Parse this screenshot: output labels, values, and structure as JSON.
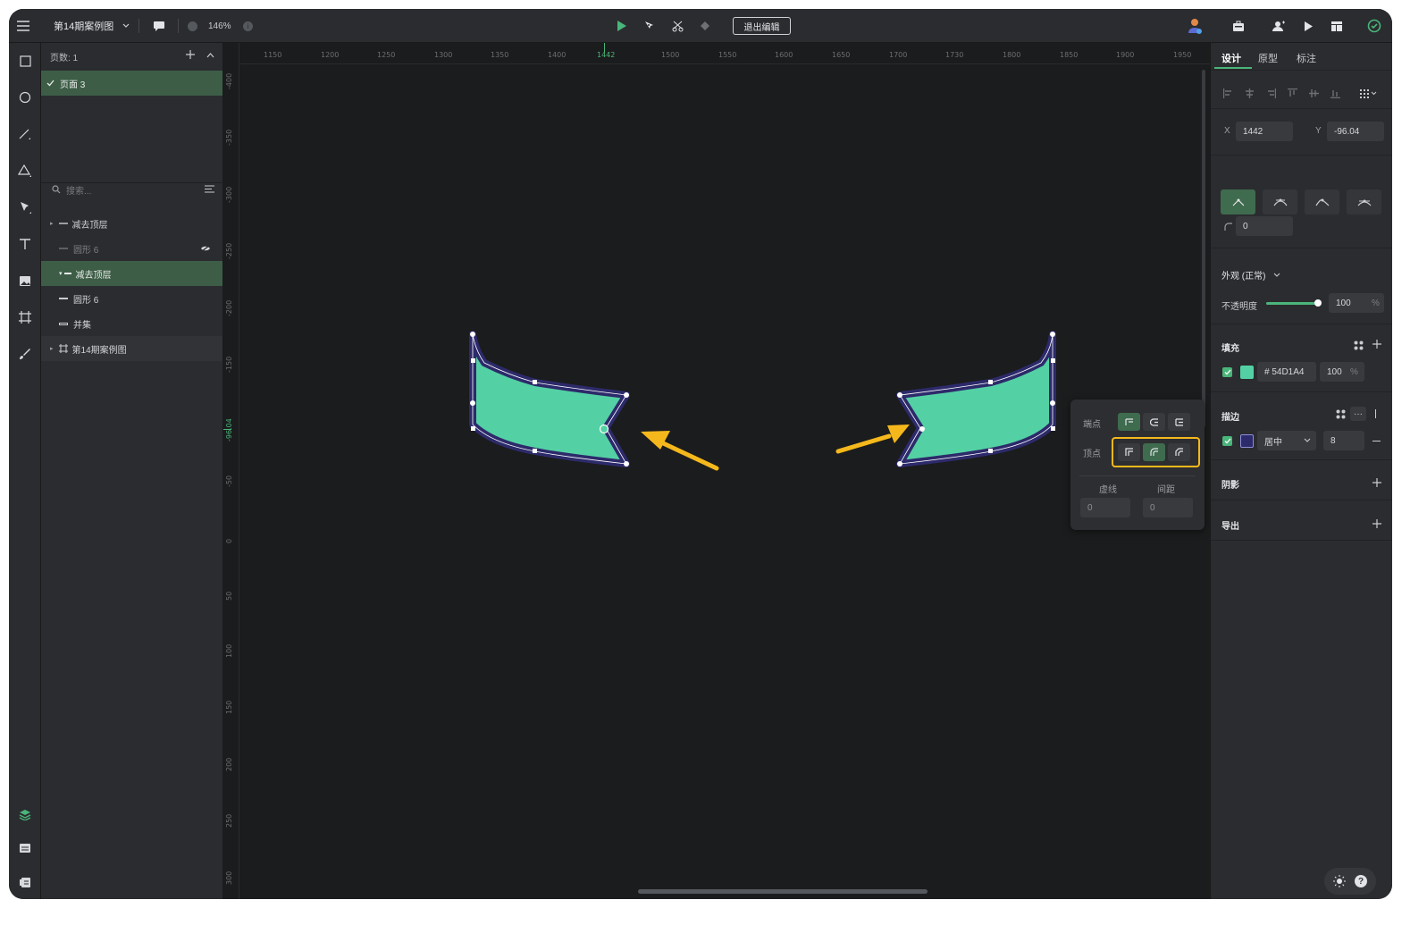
{
  "top_bar": {
    "file_name": "第14期案例图",
    "zoom": "146%",
    "exit_edit_label": "退出编辑"
  },
  "pages": {
    "count_label": "页数: 1",
    "items": [
      {
        "label": "页面 3",
        "selected": true
      }
    ]
  },
  "layers": {
    "search_placeholder": "搜索...",
    "items": [
      {
        "label": "减去顶层",
        "indent": 0,
        "state": "normal"
      },
      {
        "label": "圆形 6",
        "indent": 1,
        "state": "hidden"
      },
      {
        "label": "减去顶层",
        "indent": 1,
        "state": "selected"
      },
      {
        "label": "圆形 6",
        "indent": 1,
        "state": "normal"
      },
      {
        "label": "并集",
        "indent": 1,
        "state": "normal"
      },
      {
        "label": "第14期案例图",
        "indent": 0,
        "state": "group"
      }
    ]
  },
  "canvas": {
    "ruler_top": [
      "1150",
      "1200",
      "1250",
      "1300",
      "1350",
      "1400",
      "1442",
      "1500",
      "1550",
      "1600",
      "1650",
      "1700",
      "1730",
      "1800",
      "1850",
      "1900",
      "1950"
    ],
    "ruler_left": [
      "-400",
      "-350",
      "-300",
      "-250",
      "-200",
      "-150",
      "-96.04",
      "-50",
      "0",
      "50",
      "100",
      "150",
      "200",
      "250",
      "300"
    ],
    "shape_fill": "#54D1A4",
    "shape_stroke": "#2D2A6B",
    "arrow_color": "#F5B81C"
  },
  "vertex_popover": {
    "endpoint_label": "端点",
    "vertex_label": "顶点",
    "dash_label": "虚线",
    "gap_label": "间距",
    "dash_value": "0",
    "gap_value": "0",
    "highlight_color": "#F5B81C"
  },
  "design_panel": {
    "tabs": [
      "设计",
      "原型",
      "标注"
    ],
    "x_label": "X",
    "x_value": "1442",
    "y_label": "Y",
    "y_value": "-96.04",
    "radius_value": "0",
    "appearance_label": "外观 (正常)",
    "opacity_label": "不透明度",
    "opacity_value": "100",
    "opacity_unit": "%",
    "opacity_fraction": 1.0,
    "fill_title": "填充",
    "fill_hex": "# 54D1A4",
    "fill_opacity": "100",
    "fill_opacity_unit": "%",
    "fill_color": "#54D1A4",
    "stroke_title": "描边",
    "stroke_color": "#2D2A6B",
    "stroke_position": "居中",
    "stroke_width": "8",
    "shadow_title": "阴影",
    "export_title": "导出"
  }
}
